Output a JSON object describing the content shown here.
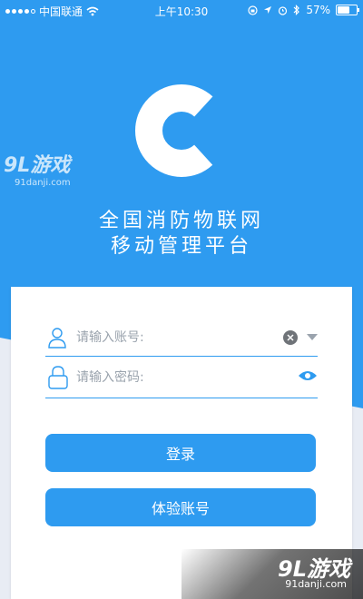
{
  "status_bar": {
    "carrier": "中国联通",
    "time": "上午10:30",
    "battery": "57%",
    "battery_level": 0.57
  },
  "app": {
    "title_line1": "全国消防物联网",
    "title_line2": "移动管理平台"
  },
  "watermark": {
    "main": "9L游戏",
    "url": "91danji.com"
  },
  "login": {
    "account_placeholder": "请输入账号:",
    "password_placeholder": "请输入密码:",
    "login_label": "登录",
    "trial_label": "体验账号"
  },
  "colors": {
    "primary": "#2e9bf0",
    "background_light": "#e8ecf4"
  },
  "icons": {
    "user_icon": "user-icon",
    "lock_icon": "lock-icon",
    "clear_icon": "clear-icon",
    "dropdown_icon": "chevron-down-icon",
    "eye_icon": "eye-icon"
  }
}
